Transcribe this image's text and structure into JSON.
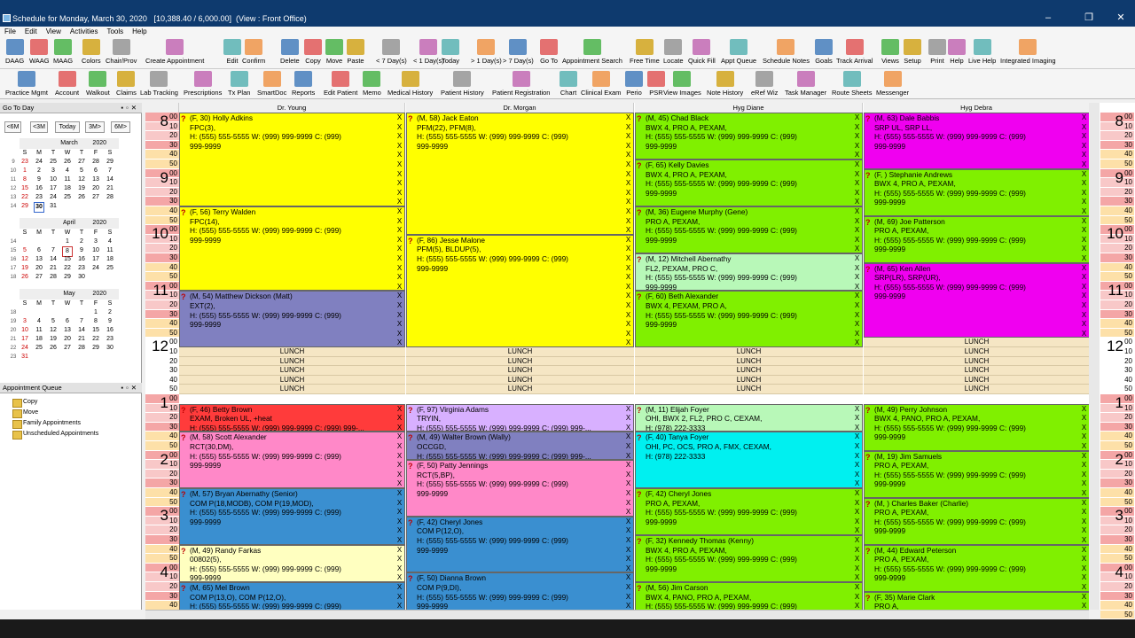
{
  "window": {
    "title": "Schedule for Monday, March 30, 2020",
    "totals": "[10,388.40 / 6,000.00]",
    "view": "(View : Front Office)"
  },
  "menu": [
    "File",
    "Edit",
    "View",
    "Activities",
    "Tools",
    "Help"
  ],
  "toolbar1": [
    "DAAG",
    "WAAG",
    "MAAG",
    "Colors",
    "Chair/Prov",
    "Create Appointment",
    "Edit",
    "Confirm",
    "Delete",
    "Copy",
    "Move",
    "Paste",
    "< 7 Day(s)",
    "< 1 Day(s)",
    "Today",
    "> 1 Day(s)",
    "> 7 Day(s)",
    "Go To",
    "Appointment Search",
    "Free Time",
    "Locate",
    "Quick Fill",
    "Appt Queue",
    "Schedule Notes",
    "Goals",
    "Track Arrival",
    "Views",
    "Setup",
    "Print",
    "Help",
    "Live Help",
    "Integrated Imaging"
  ],
  "toolbar2": [
    "Practice Mgmt",
    "Account",
    "Walkout",
    "Claims",
    "Lab Tracking",
    "Prescriptions",
    "Tx Plan",
    "SmartDoc",
    "Reports",
    "Edit Patient",
    "Memo",
    "Medical History",
    "Patient History",
    "Patient Registration",
    "Chart",
    "Clinical Exam",
    "Perio",
    "PSR",
    "View Images",
    "Note History",
    "eRef Wiz",
    "Task Manager",
    "Route Sheets",
    "Messenger"
  ],
  "goto": {
    "title": "Go To Day",
    "nav": [
      "<6M",
      "<3M",
      "Today",
      "3M>",
      "6M>"
    ],
    "months": [
      {
        "name": "March",
        "year": "2020",
        "weeks": [
          [
            "9",
            "23",
            "24",
            "25",
            "26",
            "27",
            "28",
            "29"
          ],
          [
            "10",
            "1",
            "2",
            "3",
            "4",
            "5",
            "6",
            "7"
          ],
          [
            "11",
            "8",
            "9",
            "10",
            "11",
            "12",
            "13",
            "14"
          ],
          [
            "12",
            "15",
            "16",
            "17",
            "18",
            "19",
            "20",
            "21"
          ],
          [
            "13",
            "22",
            "23",
            "24",
            "25",
            "26",
            "27",
            "28"
          ],
          [
            "14",
            "29",
            "30",
            "31",
            "",
            "",
            "",
            ""
          ]
        ]
      },
      {
        "name": "April",
        "year": "2020",
        "weeks": [
          [
            "14",
            "",
            "",
            "",
            "1",
            "2",
            "3",
            "4"
          ],
          [
            "15",
            "5",
            "6",
            "7",
            "8",
            "9",
            "10",
            "11"
          ],
          [
            "16",
            "12",
            "13",
            "14",
            "15",
            "16",
            "17",
            "18"
          ],
          [
            "17",
            "19",
            "20",
            "21",
            "22",
            "23",
            "24",
            "25"
          ],
          [
            "18",
            "26",
            "27",
            "28",
            "29",
            "30",
            "",
            ""
          ]
        ]
      },
      {
        "name": "May",
        "year": "2020",
        "weeks": [
          [
            "18",
            "",
            "",
            "",
            "",
            "",
            "1",
            "2"
          ],
          [
            "19",
            "3",
            "4",
            "5",
            "6",
            "7",
            "8",
            "9"
          ],
          [
            "20",
            "10",
            "11",
            "12",
            "13",
            "14",
            "15",
            "16"
          ],
          [
            "21",
            "17",
            "18",
            "19",
            "20",
            "21",
            "22",
            "23"
          ],
          [
            "22",
            "24",
            "25",
            "26",
            "27",
            "28",
            "29",
            "30"
          ],
          [
            "23",
            "31",
            "",
            "",
            "",
            "",
            "",
            ""
          ]
        ]
      }
    ],
    "dow": [
      "S",
      "M",
      "T",
      "W",
      "T",
      "F",
      "S"
    ]
  },
  "queue": {
    "title": "Appointment Queue",
    "items": [
      "Copy",
      "Move",
      "Family Appointments",
      "Unscheduled Appointments"
    ]
  },
  "columns": [
    "Dr. Young",
    "Dr. Morgan",
    "Hyg Diane",
    "Hyg Debra"
  ],
  "hours": [
    "8",
    "9",
    "10",
    "11",
    "12",
    "1",
    "2",
    "3",
    "4"
  ],
  "minutes": [
    "00",
    "10",
    "20",
    "30",
    "40",
    "50"
  ],
  "lunch_label": "LUNCH",
  "colors": {
    "yellow": "#ffff00",
    "pink": "#ff88c8",
    "purple": "#8080c0",
    "blue": "#3a8fd0",
    "red": "#ff3b3b",
    "lav": "#d8b0ff",
    "green": "#80f000",
    "mint": "#b8f8b8",
    "cyan": "#00f0f0",
    "magenta": "#f000f0",
    "cream": "#ffffc0",
    "lunch": "#f5e6c4"
  },
  "appointments": [
    {
      "col": 0,
      "start": 0,
      "len": 10,
      "color": "yellow",
      "lines": [
        "(F, 30) Holly Adkins",
        "FPC(3),",
        "H: (555) 555-5555 W: (999) 999-9999 C: (999)",
        "999-9999"
      ]
    },
    {
      "col": 0,
      "start": 10,
      "len": 9,
      "color": "yellow",
      "lines": [
        "(F, 56) Terry Walden",
        "FPC(14),",
        "H: (555) 555-5555 W: (999) 999-9999 C: (999)",
        "999-9999"
      ]
    },
    {
      "col": 0,
      "start": 19,
      "len": 6,
      "color": "purple",
      "lines": [
        "(M, 54) Matthew Dickson (Matt)",
        "EXT(2),",
        "H: (555) 555-5555 W: (999) 999-9999 C: (999)",
        "999-9999"
      ]
    },
    {
      "col": 0,
      "start": 31,
      "len": 3,
      "color": "red",
      "lines": [
        "(F, 46) Betty Brown",
        "EXAM, Broken UL, +heat",
        "H: (555) 555-5555 W: (999) 999-9999 C: (999) 999-..."
      ]
    },
    {
      "col": 0,
      "start": 34,
      "len": 6,
      "color": "pink",
      "lines": [
        "(M, 58) Scott Alexander",
        "RCT(30,DM),",
        "H: (555) 555-5555 W: (999) 999-9999 C: (999)",
        "999-9999"
      ]
    },
    {
      "col": 0,
      "start": 40,
      "len": 6,
      "color": "blue",
      "lines": [
        "(M, 57) Bryan Abernathy (Senior)",
        "COM P(18,MODB), COM P(19,MOD),",
        "H: (555) 555-5555 W: (999) 999-9999 C: (999)",
        "999-9999"
      ]
    },
    {
      "col": 0,
      "start": 46,
      "len": 4,
      "color": "cream",
      "lines": [
        "(M, 49) Randy Farkas",
        "00802(5),",
        "H: (555) 555-5555 W: (999) 999-9999 C: (999)",
        "999-9999"
      ]
    },
    {
      "col": 0,
      "start": 50,
      "len": 3,
      "color": "blue",
      "lines": [
        "(M, 65) Mel Brown",
        "COM P(13,O), COM P(12,O),",
        "H: (555) 555-5555 W: (999) 999-9999 C: (999)"
      ]
    },
    {
      "col": 1,
      "start": 0,
      "len": 13,
      "color": "yellow",
      "lines": [
        "(M, 58) Jack Eaton",
        "PFM(22), PFM(8),",
        "H: (555) 555-5555 W: (999) 999-9999 C: (999)",
        "999-9999"
      ]
    },
    {
      "col": 1,
      "start": 13,
      "len": 12,
      "color": "yellow",
      "lines": [
        "(F, 86) Jesse Malone",
        "PFM(5), BLDUP(5),",
        "H: (555) 555-5555 W: (999) 999-9999 C: (999)",
        "999-9999"
      ]
    },
    {
      "col": 1,
      "start": 31,
      "len": 3,
      "color": "lav",
      "lines": [
        "(F, 97) Virginia Adams",
        "TRYIN,",
        "H: (555) 555-5555 W: (999) 999-9999 C: (999) 999-..."
      ]
    },
    {
      "col": 1,
      "start": 34,
      "len": 3,
      "color": "purple",
      "lines": [
        "(M, 49) Walter Brown (Wally)",
        "OCCGD,",
        "H: (555) 555-5555 W: (999) 999-9999 C: (999) 999-..."
      ]
    },
    {
      "col": 1,
      "start": 37,
      "len": 6,
      "color": "pink",
      "lines": [
        "(F, 50) Patty Jennings",
        "RCT(5,BP),",
        "H: (555) 555-5555 W: (999) 999-9999 C: (999)",
        "999-9999"
      ]
    },
    {
      "col": 1,
      "start": 43,
      "len": 6,
      "color": "blue",
      "lines": [
        "(F, 42) Cheryl Jones",
        "COM P(12,O),",
        "H: (555) 555-5555 W: (999) 999-9999 C: (999)",
        "999-9999"
      ]
    },
    {
      "col": 1,
      "start": 49,
      "len": 4,
      "color": "blue",
      "lines": [
        "(F, 50) Dianna Brown",
        "COM P(9,DI),",
        "H: (555) 555-5555 W: (999) 999-9999 C: (999)",
        "999-9999"
      ]
    },
    {
      "col": 2,
      "start": 0,
      "len": 5,
      "color": "green",
      "lines": [
        "(M, 45) Chad Black",
        "BWX 4, PRO A, PEXAM,",
        "H: (555) 555-5555 W: (999) 999-9999 C: (999)",
        "999-9999"
      ]
    },
    {
      "col": 2,
      "start": 5,
      "len": 5,
      "color": "green",
      "lines": [
        "(F, 65) Kelly Davies",
        "BWX 4, PRO A, PEXAM,",
        "H: (555) 555-5555 W: (999) 999-9999 C: (999)",
        "999-9999"
      ]
    },
    {
      "col": 2,
      "start": 10,
      "len": 5,
      "color": "green",
      "lines": [
        "(M, 36) Eugene Murphy (Gene)",
        "PRO A, PEXAM,",
        "H: (555) 555-5555 W: (999) 999-9999 C: (999)",
        "999-9999"
      ]
    },
    {
      "col": 2,
      "start": 15,
      "len": 4,
      "color": "mint",
      "lines": [
        "(M, 12) Mitchell Abernathy",
        "FL2, PEXAM, PRO C,",
        "H: (555) 555-5555 W: (999) 999-9999 C: (999)",
        "999-9999"
      ]
    },
    {
      "col": 2,
      "start": 19,
      "len": 6,
      "color": "green",
      "lines": [
        "(F, 60) Beth Alexander",
        "BWX 4, PEXAM, PRO A,",
        "H: (555) 555-5555 W: (999) 999-9999 C: (999)",
        "999-9999"
      ]
    },
    {
      "col": 2,
      "start": 31,
      "len": 3,
      "color": "mint",
      "lines": [
        "(M, 11) Elijah Foyer",
        "OHI, BWX 2, FL2, PRO C, CEXAM,",
        "H: (978) 222-3333"
      ]
    },
    {
      "col": 2,
      "start": 34,
      "len": 6,
      "color": "cyan",
      "lines": [
        "(F, 40) Tanya Foyer",
        "OHI, PC, OCS, PRO A, FMX, CEXAM,",
        "H: (978) 222-3333"
      ]
    },
    {
      "col": 2,
      "start": 40,
      "len": 5,
      "color": "green",
      "lines": [
        "(F, 42) Cheryl Jones",
        "PRO A, PEXAM,",
        "H: (555) 555-5555 W: (999) 999-9999 C: (999)",
        "999-9999"
      ]
    },
    {
      "col": 2,
      "start": 45,
      "len": 5,
      "color": "green",
      "lines": [
        "(F, 32) Kennedy Thomas (Kenny)",
        "BWX 4, PRO A, PEXAM,",
        "H: (555) 555-5555 W: (999) 999-9999 C: (999)",
        "999-9999"
      ]
    },
    {
      "col": 2,
      "start": 50,
      "len": 3,
      "color": "green",
      "lines": [
        "(M, 56) Jim Carson",
        "BWX 4, PANO, PRO A, PEXAM,",
        "H: (555) 555-5555 W: (999) 999-9999 C: (999)"
      ]
    },
    {
      "col": 3,
      "start": 0,
      "len": 6,
      "color": "magenta",
      "lines": [
        "(M, 63) Dale Babbis",
        "SRP UL, SRP LL,",
        "H: (555) 555-5555 W: (999) 999-9999 C: (999)",
        "999-9999"
      ]
    },
    {
      "col": 3,
      "start": 6,
      "len": 5,
      "color": "green",
      "lines": [
        "(F, ) Stephanie Andrews",
        "BWX 4, PRO A, PEXAM,",
        "H: (555) 555-5555 W: (999) 999-9999 C: (999)",
        "999-9999"
      ]
    },
    {
      "col": 3,
      "start": 11,
      "len": 5,
      "color": "green",
      "lines": [
        "(M, 69) Joe Patterson",
        "PRO A, PEXAM,",
        "H: (555) 555-5555 W: (999) 999-9999 C: (999)",
        "999-9999"
      ]
    },
    {
      "col": 3,
      "start": 16,
      "len": 8,
      "color": "magenta",
      "lines": [
        "(M, 65) Ken Allen",
        "SRP(LR), SRP(UR),",
        "H: (555) 555-5555 W: (999) 999-9999 C: (999)",
        "999-9999"
      ]
    },
    {
      "col": 3,
      "start": 31,
      "len": 5,
      "color": "green",
      "lines": [
        "(M, 49) Perry Johnson",
        "BWX 4, PANO, PRO A, PEXAM,",
        "H: (555) 555-5555 W: (999) 999-9999 C: (999)",
        "999-9999"
      ]
    },
    {
      "col": 3,
      "start": 36,
      "len": 5,
      "color": "green",
      "lines": [
        "(M, 19) Jim Samuels",
        "PRO A, PEXAM,",
        "H: (555) 555-5555 W: (999) 999-9999 C: (999)",
        "999-9999"
      ]
    },
    {
      "col": 3,
      "start": 41,
      "len": 5,
      "color": "green",
      "lines": [
        "(M, ) Charles Baker (Charlie)",
        "PRO A, PEXAM,",
        "H: (555) 555-5555 W: (999) 999-9999 C: (999)",
        "999-9999"
      ]
    },
    {
      "col": 3,
      "start": 46,
      "len": 5,
      "color": "green",
      "lines": [
        "(M, 44) Edward Peterson",
        "PRO A, PEXAM,",
        "H: (555) 555-5555 W: (999) 999-9999 C: (999)",
        "999-9999"
      ]
    },
    {
      "col": 3,
      "start": 51,
      "len": 2,
      "color": "green",
      "lines": [
        "(F, 35) Marie Clark",
        "PRO A,"
      ]
    }
  ]
}
